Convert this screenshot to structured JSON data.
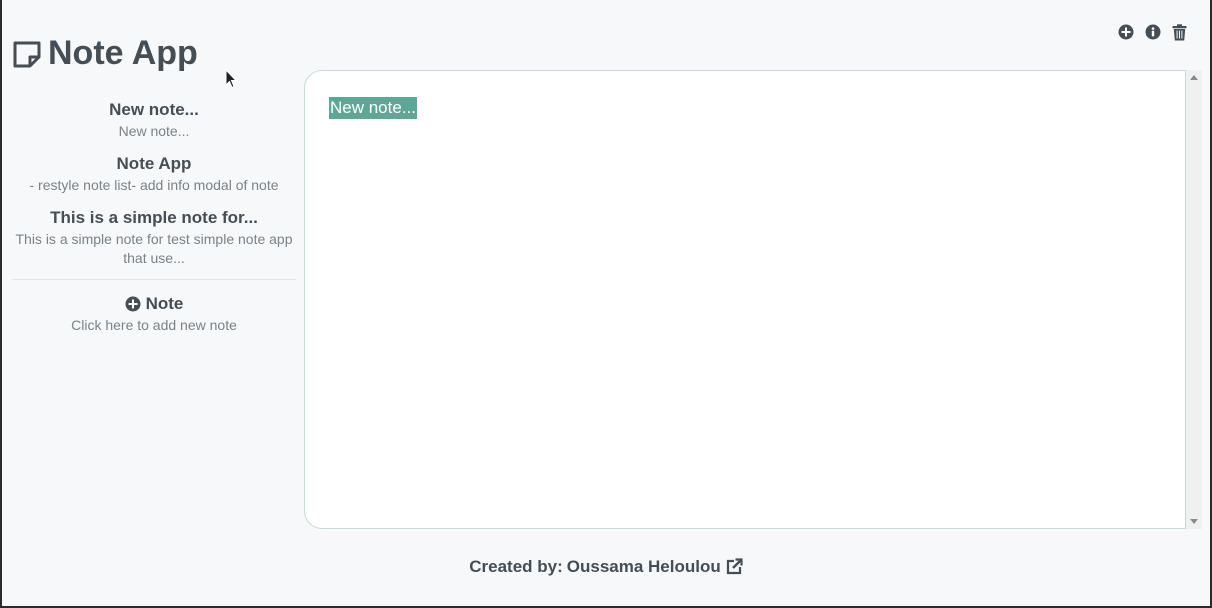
{
  "header": {
    "title": "Note App",
    "icon": "sticky-note-icon"
  },
  "toolbar": {
    "add_icon": "plus-circle-icon",
    "info_icon": "info-circle-icon",
    "delete_icon": "trash-icon"
  },
  "sidebar": {
    "notes": [
      {
        "title": "New note...",
        "preview": "New note..."
      },
      {
        "title": "Note App",
        "preview": "- restyle note list- add info modal of note"
      },
      {
        "title": "This is a simple note for...",
        "preview": "This is a simple note for test simple note app that use..."
      }
    ],
    "add_item": {
      "title": "Note",
      "subtitle": "Click here to add new note",
      "icon": "plus-circle-icon"
    }
  },
  "editor": {
    "content": "New note...",
    "selection_color": "#5ea796"
  },
  "footer": {
    "text": "Created by:",
    "author": "Oussama Heloulou",
    "link_icon": "external-link-icon"
  },
  "colors": {
    "text": "#454d55",
    "muted": "#7a8288",
    "accent": "#5ea796",
    "background": "#f6f8f9"
  }
}
